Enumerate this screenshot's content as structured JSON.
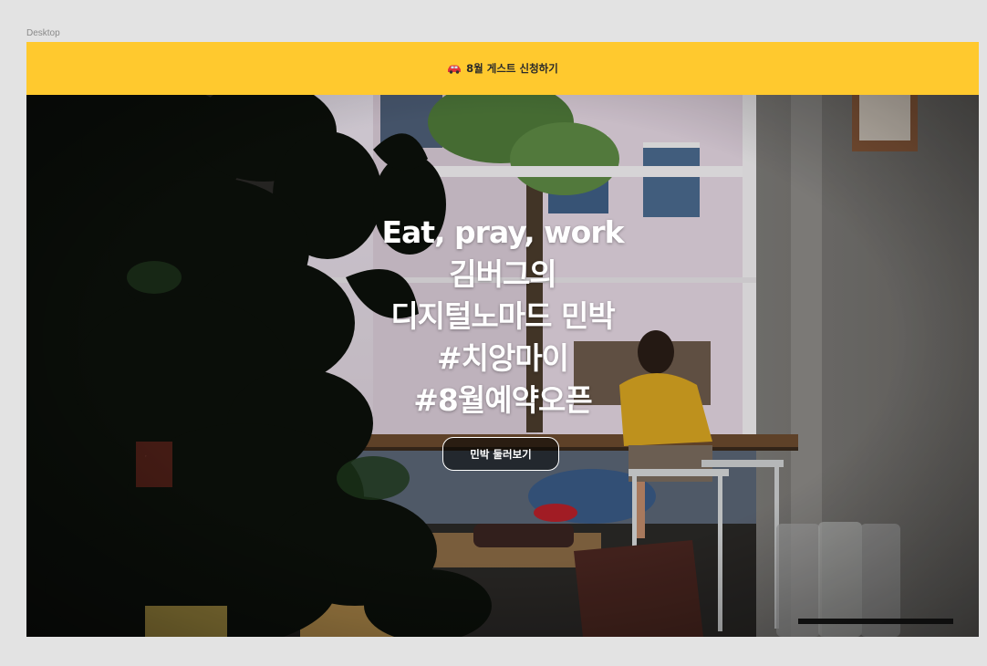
{
  "canvas": {
    "frame_label": "Desktop"
  },
  "banner": {
    "icon": "car-icon",
    "text": "8월 게스트 신청하기",
    "color": "#ffc92e"
  },
  "hero": {
    "lines": [
      "Eat, pray, work",
      "김버그의",
      "디지털노마드 민박",
      "#치앙마이",
      "#8월예약오픈"
    ],
    "button_label": "민박 둘러보기"
  }
}
